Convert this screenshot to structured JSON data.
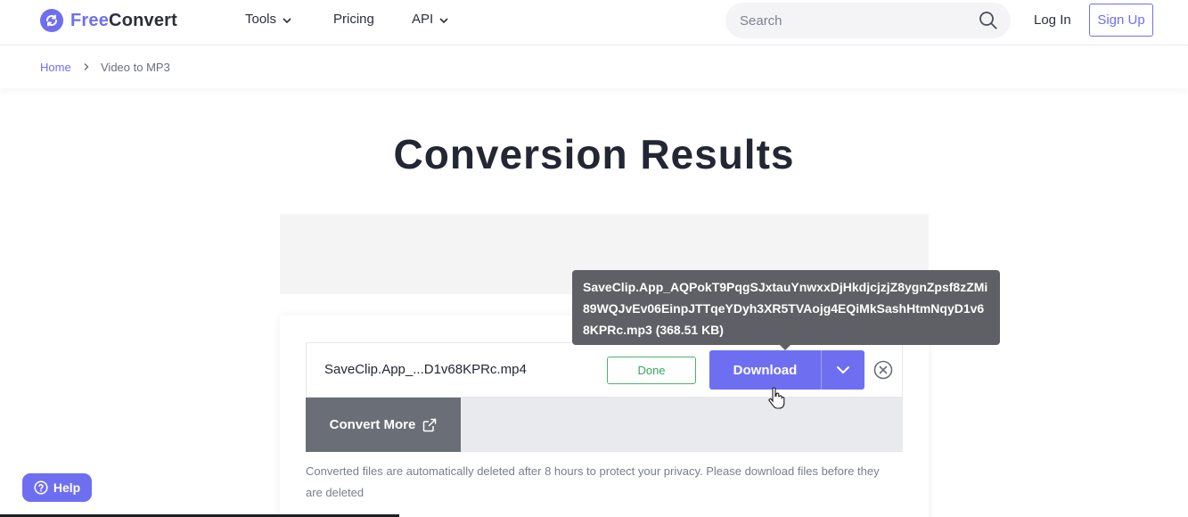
{
  "header": {
    "logo_free": "Free",
    "logo_convert": "Convert",
    "nav": [
      {
        "label": "Tools",
        "has_dropdown": true
      },
      {
        "label": "Pricing",
        "has_dropdown": false
      },
      {
        "label": "API",
        "has_dropdown": true
      }
    ],
    "search_placeholder": "Search",
    "login_label": "Log In",
    "signup_label": "Sign Up"
  },
  "breadcrumb": {
    "home": "Home",
    "current": "Video to MP3"
  },
  "main": {
    "title": "Conversion Results",
    "file": {
      "name": "SaveClip.App_...D1v68KPRc.mp4",
      "status": "Done",
      "download_label": "Download"
    },
    "convert_more_label": "Convert More",
    "notice": "Converted files are automatically deleted after 8 hours to protect your privacy. Please download files before they are deleted"
  },
  "tooltip": {
    "text": "SaveClip.App_AQPokT9PqgSJxtauYnwxxDjHkdjcjzjZ8ygnZpsf8zZMi89WQJvEv06EinpJTTqeYDyh3XR5TVAojg4EQiMkSashHtmNqyD1v68KPRc.mp3 (368.51 KB)"
  },
  "help_label": "Help",
  "colors": {
    "brand": "#6e6ff0",
    "done_green": "#3aa55b",
    "convert_more_bg": "#6a6f77",
    "tooltip_bg": "#5f6065"
  },
  "icons": [
    "logo-sync-icon",
    "chevron-down-icon",
    "search-icon",
    "chevron-right-icon",
    "close-circle-icon",
    "external-link-icon",
    "question-circle-icon",
    "hand-cursor-icon"
  ]
}
